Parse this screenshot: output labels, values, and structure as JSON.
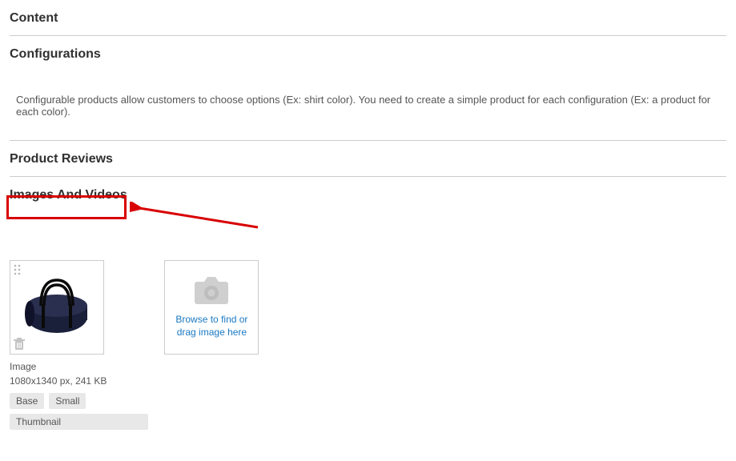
{
  "sections": {
    "content": {
      "title": "Content"
    },
    "configurations": {
      "title": "Configurations",
      "description": "Configurable products allow customers to choose options (Ex: shirt color). You need to create a simple product for each configuration (Ex: a product for each color)."
    },
    "product_reviews": {
      "title": "Product Reviews"
    },
    "images_and_videos": {
      "title": "Images And Videos"
    }
  },
  "upload": {
    "text": "Browse to find or drag image here"
  },
  "image_item": {
    "caption": "Image",
    "resolution": "1080x1340 px, 241 KB",
    "tags": [
      "Base",
      "Small",
      "Thumbnail"
    ]
  },
  "colors": {
    "link": "#1979c3",
    "annot": "#d80000"
  }
}
